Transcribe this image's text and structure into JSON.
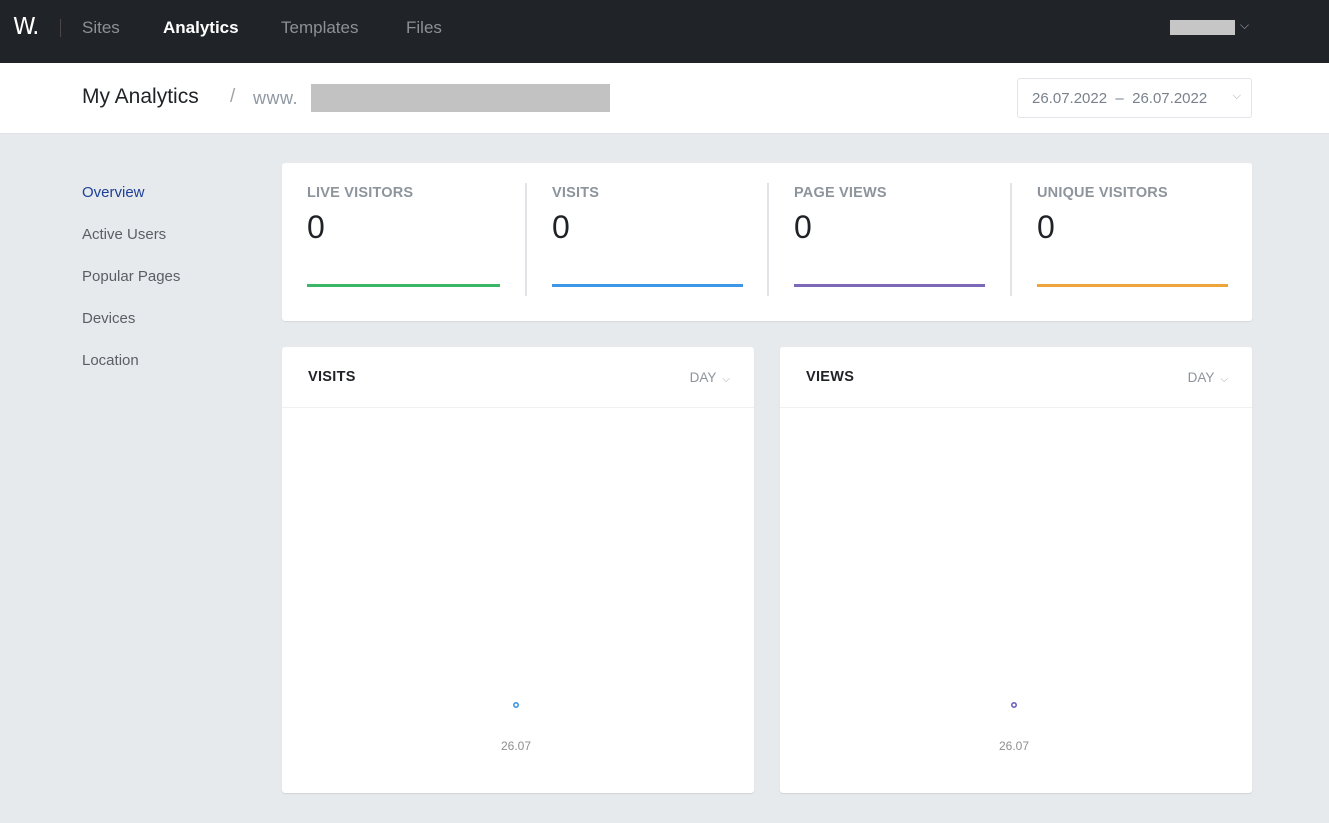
{
  "topnav": {
    "logo": "W.",
    "items": [
      {
        "label": "Sites",
        "active": false
      },
      {
        "label": "Analytics",
        "active": true
      },
      {
        "label": "Templates",
        "active": false
      },
      {
        "label": "Files",
        "active": false
      }
    ],
    "user_menu_icon": "chevron-down-icon"
  },
  "subheader": {
    "title": "My Analytics",
    "separator": "/",
    "site_prefix": "www.",
    "date_range": {
      "start": "26.07.2022",
      "dash": "–",
      "end": "26.07.2022"
    }
  },
  "sidebar": {
    "items": [
      {
        "label": "Overview",
        "active": true
      },
      {
        "label": "Active Users",
        "active": false
      },
      {
        "label": "Popular Pages",
        "active": false
      },
      {
        "label": "Devices",
        "active": false
      },
      {
        "label": "Location",
        "active": false
      }
    ]
  },
  "stats": [
    {
      "label": "LIVE VISITORS",
      "value": "0",
      "color": "#3bb566"
    },
    {
      "label": "VISITS",
      "value": "0",
      "color": "#3d97e6"
    },
    {
      "label": "PAGE VIEWS",
      "value": "0",
      "color": "#7b68b8"
    },
    {
      "label": "UNIQUE VISITORS",
      "value": "0",
      "color": "#eda43b"
    }
  ],
  "charts": [
    {
      "title": "VISITS",
      "period": "DAY",
      "color": "#3d97e6"
    },
    {
      "title": "VIEWS",
      "period": "DAY",
      "color": "#6f5fc0"
    }
  ],
  "chart_data": [
    {
      "type": "line",
      "title": "VISITS",
      "x": [
        "26.07"
      ],
      "series": [
        {
          "name": "Visits",
          "values": [
            0
          ]
        }
      ],
      "xlabel": "",
      "ylabel": "",
      "grid": false
    },
    {
      "type": "line",
      "title": "VIEWS",
      "x": [
        "26.07"
      ],
      "series": [
        {
          "name": "Views",
          "values": [
            0
          ]
        }
      ],
      "xlabel": "",
      "ylabel": "",
      "grid": false
    }
  ]
}
